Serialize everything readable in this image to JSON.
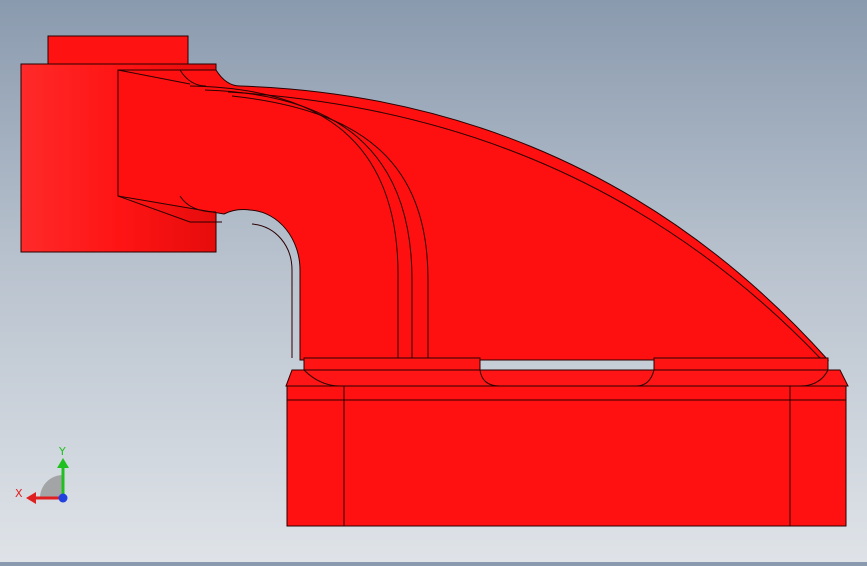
{
  "viewport": {
    "model_color": "#ff1010",
    "edge_color": "#2a0000",
    "background_top": "#8a9aae",
    "background_bottom": "#dfe3e8"
  },
  "triad": {
    "x_label": "X",
    "y_label": "Y",
    "x_color": "#e02020",
    "y_color": "#20c020",
    "z_color": "#2040e0"
  }
}
